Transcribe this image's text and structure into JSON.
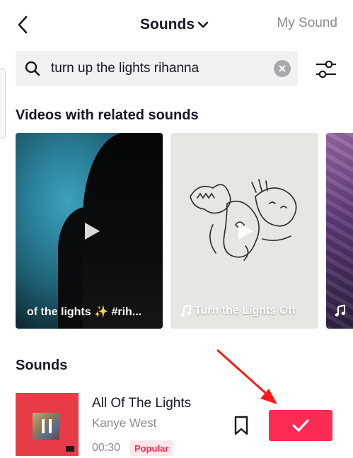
{
  "header": {
    "back_icon": "chevron-left-icon",
    "title": "Sounds",
    "title_dropdown_icon": "chevron-down-icon",
    "my_sound_label": "My Sound"
  },
  "search": {
    "icon": "search-icon",
    "query": "turn up the lights rihanna",
    "clear_icon": "close-icon",
    "filter_icon": "sliders-icon"
  },
  "related_videos": {
    "heading": "Videos with related sounds",
    "cards": [
      {
        "caption": "of the lights ✨ #rih...",
        "has_music_note": false
      },
      {
        "caption": "Turn the Lights Off",
        "has_music_note": true
      },
      {
        "caption": "",
        "has_music_note": true
      }
    ]
  },
  "sounds": {
    "heading": "Sounds",
    "items": [
      {
        "title": "All Of The Lights",
        "artist": "Kanye West",
        "duration": "00:30",
        "badge": "Popular",
        "bookmark_icon": "bookmark-icon",
        "action_icon": "checkmark-icon"
      }
    ]
  },
  "annotation": {
    "arrow_icon": "red-arrow-icon"
  },
  "colors": {
    "accent": "#fe2c55",
    "text_primary": "#161823",
    "text_secondary": "#8a8b91",
    "search_bg": "#f1f1f2",
    "badge_bg": "#fde7ea"
  }
}
